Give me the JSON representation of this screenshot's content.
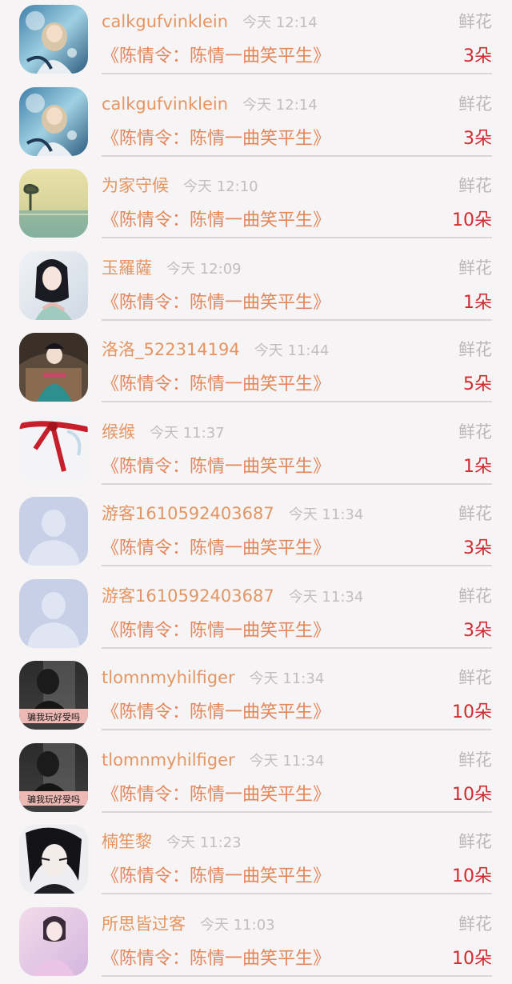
{
  "gifts": [
    {
      "name": "calkgufvinklein",
      "time": "今天 12:14",
      "type": "鲜花",
      "title": "《陈情令：陈情一曲笑平生》",
      "count": "3朵",
      "avatar": "anime-girl-blue"
    },
    {
      "name": "calkgufvinklein",
      "time": "今天 12:14",
      "type": "鲜花",
      "title": "《陈情令：陈情一曲笑平生》",
      "count": "3朵",
      "avatar": "anime-girl-blue"
    },
    {
      "name": "为家守候",
      "time": "今天 12:10",
      "type": "鲜花",
      "title": "《陈情令：陈情一曲笑平生》",
      "count": "10朵",
      "avatar": "landscape-tree"
    },
    {
      "name": "玉羅薩",
      "time": "今天 12:09",
      "type": "鲜花",
      "title": "《陈情令：陈情一曲笑平生》",
      "count": "1朵",
      "avatar": "ancient-lady"
    },
    {
      "name": "洛洛_522314194",
      "time": "今天 11:44",
      "type": "鲜花",
      "title": "《陈情令：陈情一曲笑平生》",
      "count": "5朵",
      "avatar": "ancient-gate-lady"
    },
    {
      "name": "缑缑",
      "time": "今天 11:37",
      "type": "鲜花",
      "title": "《陈情令：陈情一曲笑平生》",
      "count": "1朵",
      "avatar": "red-ribbon"
    },
    {
      "name": "游客1610592403687",
      "time": "今天 11:34",
      "type": "鲜花",
      "title": "《陈情令：陈情一曲笑平生》",
      "count": "3朵",
      "avatar": "default-user"
    },
    {
      "name": "游客1610592403687",
      "time": "今天 11:34",
      "type": "鲜花",
      "title": "《陈情令：陈情一曲笑平生》",
      "count": "3朵",
      "avatar": "default-user"
    },
    {
      "name": "tlomnmyhilfiger",
      "time": "今天 11:34",
      "type": "鲜花",
      "title": "《陈情令：陈情一曲笑平生》",
      "count": "10朵",
      "avatar": "dark-photo",
      "caption": "骗我玩好受吗"
    },
    {
      "name": "tlomnmyhilfiger",
      "time": "今天 11:34",
      "type": "鲜花",
      "title": "《陈情令：陈情一曲笑平生》",
      "count": "10朵",
      "avatar": "dark-photo",
      "caption": "骗我玩好受吗"
    },
    {
      "name": "楠笙黎",
      "time": "今天 11:23",
      "type": "鲜花",
      "title": "《陈情令：陈情一曲笑平生》",
      "count": "10朵",
      "avatar": "anime-boy-dark"
    },
    {
      "name": "所思皆过客",
      "time": "今天 11:03",
      "type": "鲜花",
      "title": "《陈情令：陈情一曲笑平生》",
      "count": "10朵",
      "avatar": "pink-lady"
    }
  ]
}
